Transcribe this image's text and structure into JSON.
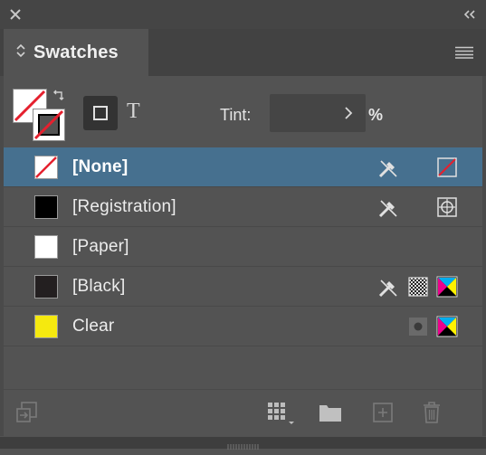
{
  "panel": {
    "title": "Swatches"
  },
  "controls": {
    "tint_label": "Tint:",
    "tint_value": "",
    "tint_unit": "%",
    "text_button_glyph": "T"
  },
  "swatches": [
    {
      "name": "[None]",
      "chip": "none",
      "selected": true,
      "icons": [
        "no-edit-icon",
        "none-type-icon"
      ]
    },
    {
      "name": "[Registration]",
      "chip": "#000000",
      "selected": false,
      "icons": [
        "no-edit-icon",
        "registration-type-icon"
      ]
    },
    {
      "name": "[Paper]",
      "chip": "#ffffff",
      "selected": false,
      "icons": []
    },
    {
      "name": "[Black]",
      "chip": "#231f20",
      "selected": false,
      "icons": [
        "no-edit-icon",
        "overprint-icon",
        "cmyk-icon"
      ]
    },
    {
      "name": "Clear",
      "chip": "#f5e90f",
      "selected": false,
      "icons": [
        "spot-icon",
        "cmyk-icon"
      ]
    }
  ],
  "colors": {
    "selection": "#46708f",
    "panel_bg": "#535353",
    "accent_red": "#e5202e"
  }
}
